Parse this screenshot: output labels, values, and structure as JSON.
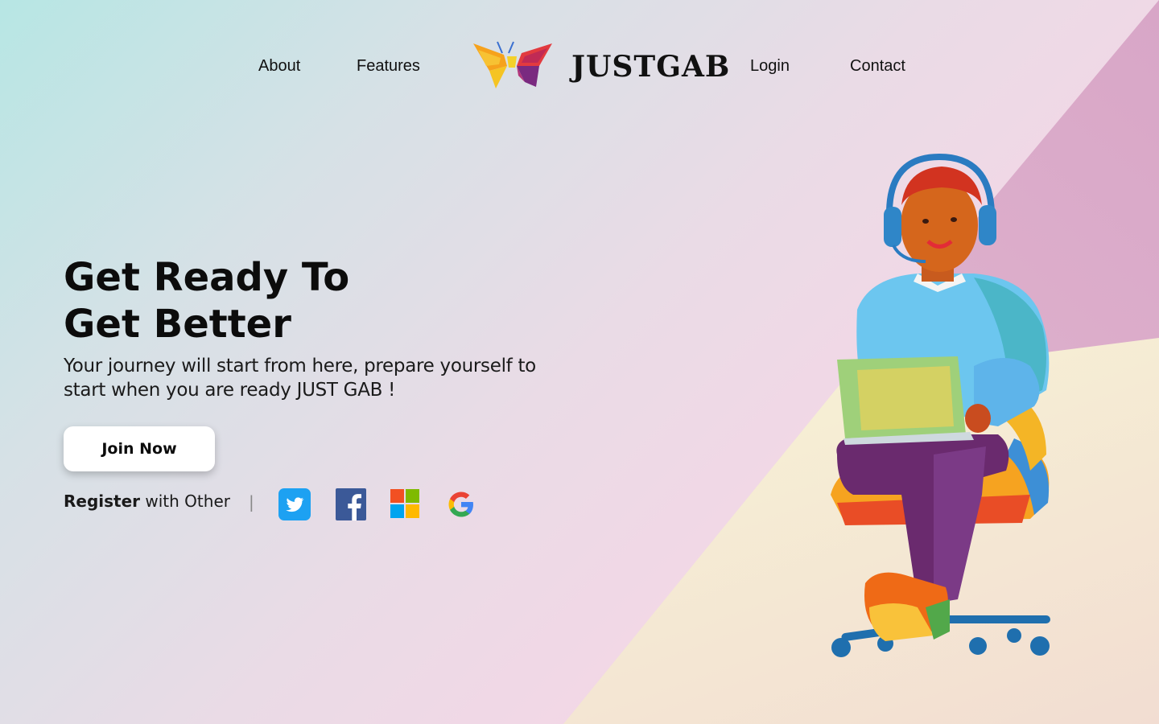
{
  "brand": {
    "name": "JUSTGAB"
  },
  "nav": {
    "about": "About",
    "features": "Features",
    "login": "Login",
    "contact": "Contact"
  },
  "hero": {
    "title_line1": "Get Ready To",
    "title_line2": "Get Better",
    "subtitle": "Your journey will start from here, prepare yourself to start when you are ready JUST GAB !",
    "cta_label": "Join Now"
  },
  "register": {
    "bold": "Register",
    "rest": " with Other",
    "divider": "|",
    "providers": [
      "twitter-icon",
      "facebook-icon",
      "microsoft-icon",
      "google-icon"
    ]
  },
  "colors": {
    "twitter": "#1da1f2",
    "facebook": "#3b5998",
    "ms_red": "#f25022",
    "ms_green": "#7fba00",
    "ms_blue": "#00a4ef",
    "ms_yellow": "#ffb900"
  }
}
